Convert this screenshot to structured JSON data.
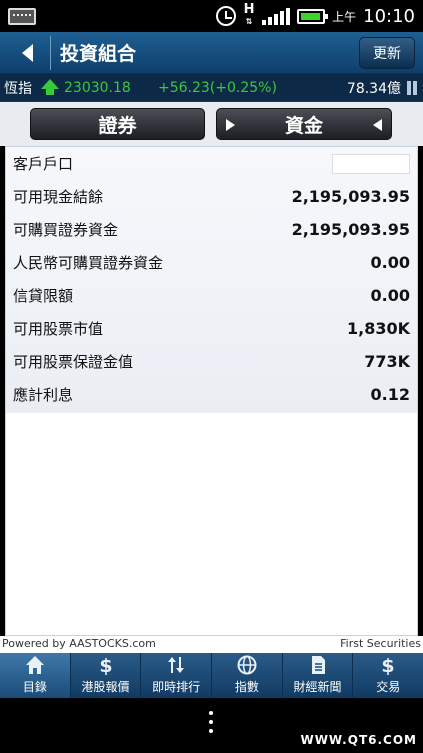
{
  "status_bar": {
    "h_indicator": "H",
    "am_pm": "上午",
    "time": "10:10"
  },
  "header": {
    "title": "投資組合",
    "refresh_label": "更新"
  },
  "ticker": {
    "name": "恆指",
    "index_value": "23030.18",
    "change": "+56.23(+0.25%)",
    "turnover": "78.34億"
  },
  "tabs": [
    {
      "label": "證券"
    },
    {
      "label": "資金"
    }
  ],
  "rows": [
    {
      "label": "客戶戶口",
      "value": ""
    },
    {
      "label": "可用現金結餘",
      "value": "2,195,093.95"
    },
    {
      "label": "可購買證券資金",
      "value": "2,195,093.95"
    },
    {
      "label": "人民幣可購買證券資金",
      "value": "0.00"
    },
    {
      "label": "信貸限額",
      "value": "0.00"
    },
    {
      "label": "可用股票市值",
      "value": "1,830K"
    },
    {
      "label": "可用股票保證金值",
      "value": "773K"
    },
    {
      "label": "應計利息",
      "value": "0.12"
    }
  ],
  "footer": {
    "powered_by": "Powered by AASTOCKS.com",
    "broker": "First Securities"
  },
  "nav": [
    {
      "label": "目錄",
      "icon": "home-icon"
    },
    {
      "label": "港股報價",
      "icon": "dollar-icon"
    },
    {
      "label": "即時排行",
      "icon": "sort-arrows-icon"
    },
    {
      "label": "指數",
      "icon": "globe-icon"
    },
    {
      "label": "財經新聞",
      "icon": "document-icon"
    },
    {
      "label": "交易",
      "icon": "dollar-icon"
    }
  ],
  "watermark": "WWW.QT6.COM",
  "colors": {
    "header_blue": "#0e3f6c",
    "up_green": "#38c93c",
    "nav_blue": "#2a5b88"
  }
}
